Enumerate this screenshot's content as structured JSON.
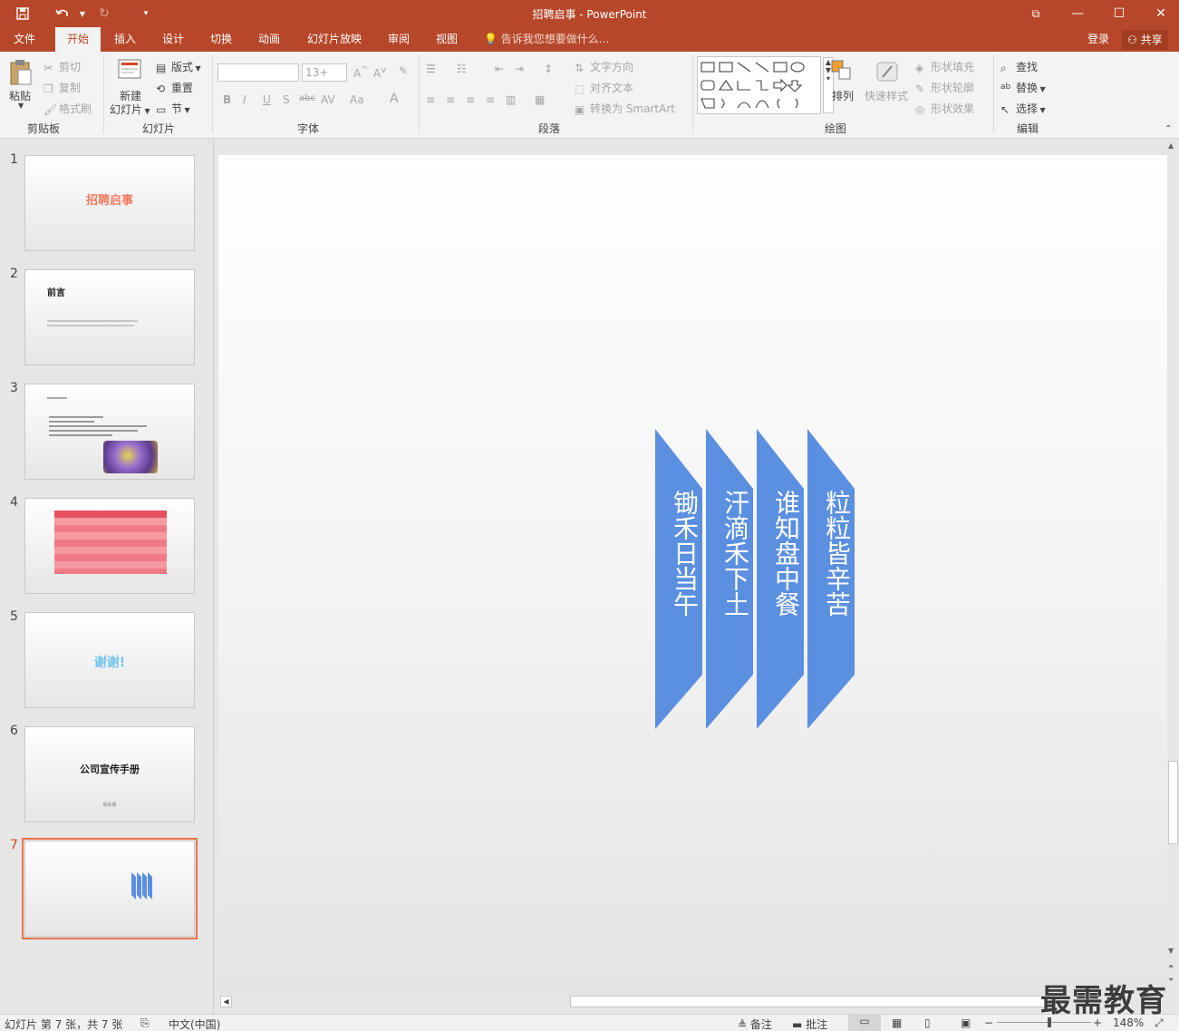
{
  "titlebar": {
    "title": "招聘启事 - PowerPoint",
    "restore_icon": "⧉",
    "minimize": "—",
    "maximize": "☐",
    "close": "✕"
  },
  "tabs": [
    {
      "label": "文件"
    },
    {
      "label": "开始"
    },
    {
      "label": "插入"
    },
    {
      "label": "设计"
    },
    {
      "label": "切换"
    },
    {
      "label": "动画"
    },
    {
      "label": "幻灯片放映"
    },
    {
      "label": "审阅"
    },
    {
      "label": "视图"
    }
  ],
  "tell_me": "告诉我您想要做什么...",
  "account": {
    "login": "登录",
    "share": "共享"
  },
  "ribbon": {
    "clipboard": {
      "paste": "粘贴",
      "cut": "剪切",
      "copy": "复制",
      "format_painter": "格式刷",
      "label": "剪贴板"
    },
    "slides": {
      "new_slide_1": "新建",
      "new_slide_2": "幻灯片",
      "layout": "版式",
      "reset": "重置",
      "section": "节",
      "label": "幻灯片"
    },
    "font": {
      "size": "13+",
      "label": "字体"
    },
    "paragraph": {
      "text_direction": "文字方向",
      "align_text": "对齐文本",
      "smartart": "转换为 SmartArt",
      "label": "段落"
    },
    "drawing": {
      "arrange": "排列",
      "quick_styles": "快速样式",
      "shape_fill": "形状填充",
      "shape_outline": "形状轮廓",
      "shape_effects": "形状效果",
      "label": "绘图"
    },
    "editing": {
      "find": "查找",
      "replace": "替换",
      "select": "选择",
      "label": "编辑"
    }
  },
  "thumbnails": [
    {
      "num": "1",
      "title": "招聘启事"
    },
    {
      "num": "2",
      "title": "前言"
    },
    {
      "num": "3",
      "title": ""
    },
    {
      "num": "4",
      "title": ""
    },
    {
      "num": "5",
      "title": "谢谢!"
    },
    {
      "num": "6",
      "title": "公司宣传手册",
      "sub": "最新版"
    },
    {
      "num": "7",
      "title": ""
    }
  ],
  "slide": {
    "columns": [
      {
        "text": "锄禾日当午"
      },
      {
        "text": "汗滴禾下土"
      },
      {
        "text": "谁知盘中餐"
      },
      {
        "text": "粒粒皆辛苦"
      }
    ],
    "shape_color": "#5b8fe0"
  },
  "statusbar": {
    "slide_info": "幻灯片 第 7 张，共 7 张",
    "language": "中文(中国)",
    "notes": "备注",
    "comments": "批注",
    "zoom": "148%"
  },
  "watermark": "最需教育"
}
